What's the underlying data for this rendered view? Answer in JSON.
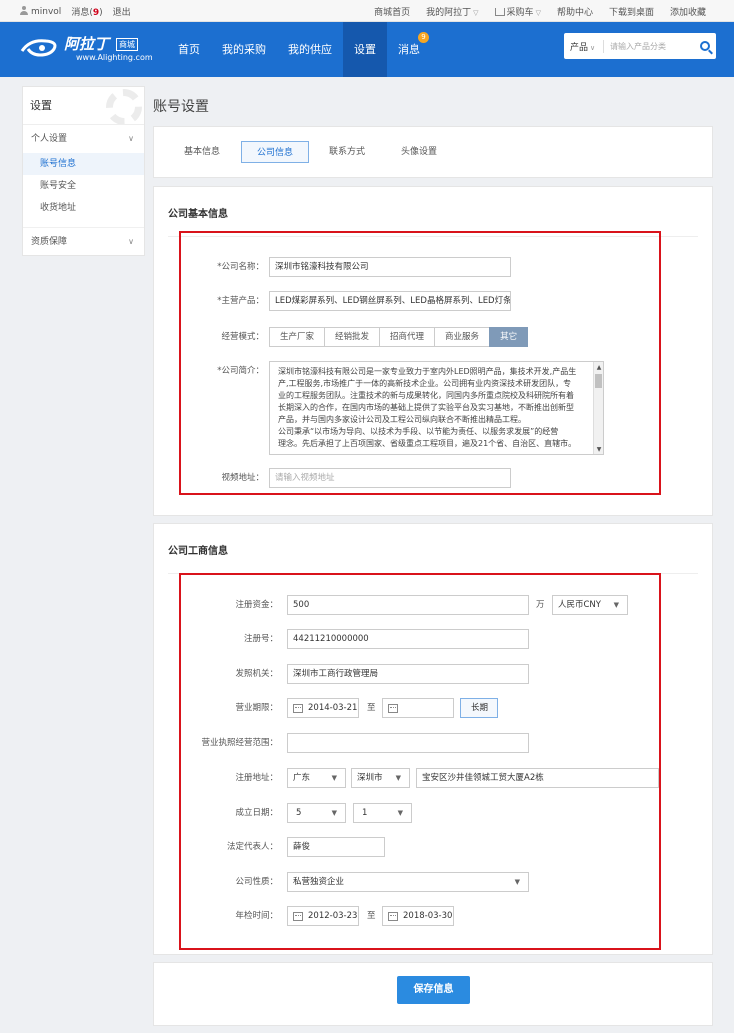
{
  "topbar": {
    "username": "minvol",
    "messages_label": "消息(",
    "messages_count": "9",
    "messages_suffix": ")",
    "logout": "退出",
    "links": [
      "商城首页",
      "我的阿拉丁",
      "采购车",
      "帮助中心",
      "下载到桌面",
      "添加收藏"
    ]
  },
  "logo": {
    "cn": "阿拉丁",
    "tag": "商城",
    "en": "www.Alighting.com"
  },
  "nav": {
    "items": [
      "首页",
      "我的采购",
      "我的供应",
      "设置",
      "消息"
    ],
    "badge": "9"
  },
  "search": {
    "category": "产品",
    "placeholder": "请输入产品分类"
  },
  "sidebar": {
    "title": "设置",
    "group1": "个人设置",
    "items": [
      "账号信息",
      "账号安全",
      "收货地址"
    ],
    "group2": "资质保障"
  },
  "page_title": "账号设置",
  "tabs": [
    "基本信息",
    "公司信息",
    "联系方式",
    "头像设置"
  ],
  "basic": {
    "title": "公司基本信息",
    "name_label": "*公司名称：",
    "name_value": "深圳市铭濠科技有限公司",
    "product_label": "*主营产品：",
    "product_value": "LED煤彩屏系列、LED钢丝屏系列、LED晶格屏系列、LED灯条屏",
    "mode_label": "经营模式：",
    "modes": [
      "生产厂家",
      "经销批发",
      "招商代理",
      "商业服务",
      "其它"
    ],
    "intro_label": "*公司简介：",
    "intro_lines": [
      "深圳市铭濠科技有限公司是一家专业致力于室内外LED照明产品，集技术开发,产品生",
      "产,工程服务,市场推广于一体的高新技术企业。公司拥有业内资深技术研发团队，专",
      "业的工程服务团队。注重技术的新与成果转化，同国内多所重点院校及科研院所有着",
      "长期深入的合作，在国内市场的基础上提供了实验平台及实习基地，不断推出创新型",
      "产品，并与国内多家设计公司及工程公司纵向联合不断推出精品工程。",
      "公司秉承“以市场为导向、以技术为手段、以节能为责任、以服务求发展”的经营",
      "理念。先后承担了上百项国家、省级重点工程项目，遍及21个省、自治区、直辖市。"
    ],
    "video_label": "视频地址：",
    "video_placeholder": "请输入视频地址"
  },
  "business": {
    "title": "公司工商信息",
    "capital_label": "注册资金：",
    "capital_value": "500",
    "capital_unit": "万",
    "currency": "人民币CNY",
    "regno_label": "注册号：",
    "regno_value": "44211210000000",
    "authority_label": "发照机关：",
    "authority_value": "深圳市工商行政管理局",
    "term_label": "营业期限：",
    "term_start": "2014-03-21",
    "term_to": "至",
    "term_end": "",
    "term_long": "长期",
    "scope_label": "营业执照经营范围：",
    "scope_value": "",
    "address_label": "注册地址：",
    "province": "广东",
    "city": "深圳市",
    "address_value": "宝安区沙井佳领城工贸大厦A2栋",
    "founded_label": "成立日期：",
    "founded_month": "5",
    "founded_day": "1",
    "legal_label": "法定代表人：",
    "legal_value": "薛俊",
    "nature_label": "公司性质：",
    "nature_value": "私营独资企业",
    "inspect_label": "年检时间：",
    "inspect_start": "2012-03-23",
    "inspect_to": "至",
    "inspect_end": "2018-03-30"
  },
  "save_label": "保存信息",
  "colors": {
    "brand": "#1c6fd0",
    "highlight_box": "#d9131b",
    "save_button": "#2b8be0"
  }
}
